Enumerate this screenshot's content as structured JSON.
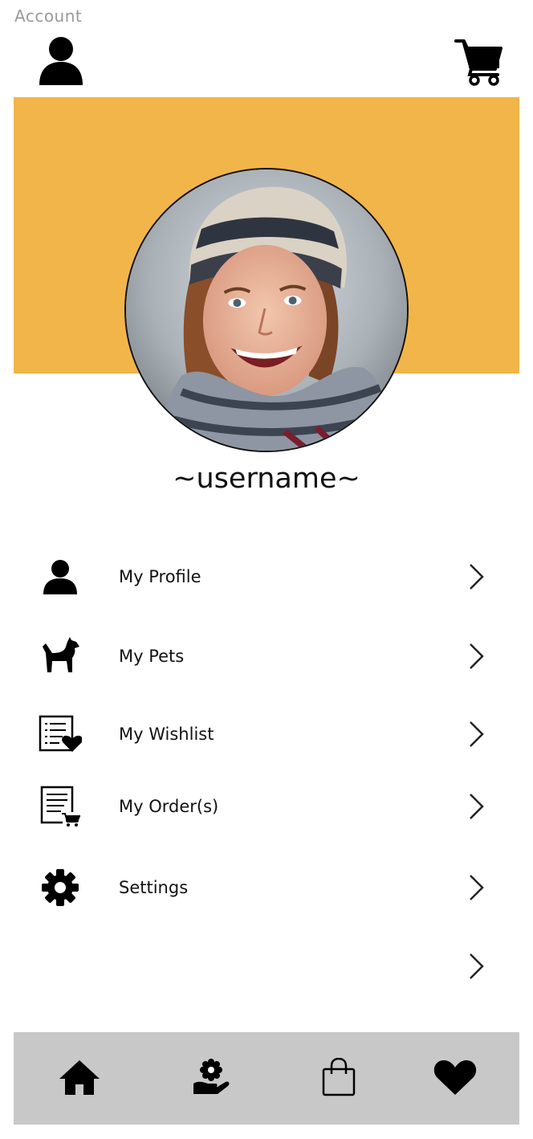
{
  "header": {
    "title": "Account"
  },
  "colors": {
    "banner": "#f1b54a",
    "nav_background": "#c8c8c8",
    "icon": "#000000",
    "title_text": "#9a9a9a"
  },
  "profile": {
    "username": "~username~"
  },
  "menu": {
    "items": [
      {
        "label": "My Profile",
        "icon": "user-icon"
      },
      {
        "label": "My Pets",
        "icon": "dog-icon"
      },
      {
        "label": "My Wishlist",
        "icon": "wishlist-icon"
      },
      {
        "label": "My Order(s)",
        "icon": "orders-icon"
      },
      {
        "label": "Settings",
        "icon": "gear-icon"
      },
      {
        "label": "",
        "icon": ""
      }
    ]
  },
  "bottom_nav": {
    "items": [
      {
        "icon": "home-icon"
      },
      {
        "icon": "pet-care-icon"
      },
      {
        "icon": "shopping-bag-icon"
      },
      {
        "icon": "heart-icon"
      }
    ]
  }
}
